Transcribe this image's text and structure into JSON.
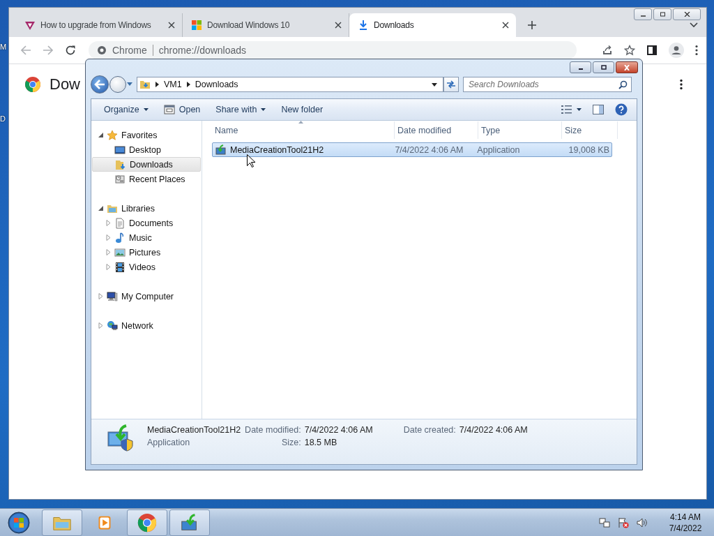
{
  "desktop": {
    "icon_labels": [
      "M",
      "D"
    ]
  },
  "browser": {
    "tabs": [
      {
        "title": "How to upgrade from Windows",
        "selected": false
      },
      {
        "title": "Download Windows 10",
        "selected": false
      },
      {
        "title": "Downloads",
        "selected": true
      }
    ],
    "address": {
      "site_label": "Chrome",
      "url": "chrome://downloads"
    },
    "page": {
      "heading": "Dow"
    }
  },
  "explorer": {
    "breadcrumb": [
      "VM1",
      "Downloads"
    ],
    "search": {
      "placeholder": "Search Downloads"
    },
    "commands": [
      {
        "label": "Organize",
        "menu": true
      },
      {
        "label": "Open",
        "menu": false
      },
      {
        "label": "Share with",
        "menu": true
      },
      {
        "label": "New folder",
        "menu": false
      }
    ],
    "nav": [
      {
        "label": "Favorites",
        "expanded": true,
        "children": [
          {
            "label": "Desktop",
            "selected": false
          },
          {
            "label": "Downloads",
            "selected": true
          },
          {
            "label": "Recent Places",
            "selected": false
          }
        ]
      },
      {
        "label": "Libraries",
        "expanded": true,
        "children": [
          {
            "label": "Documents",
            "selected": false,
            "expanded": false
          },
          {
            "label": "Music",
            "selected": false,
            "expanded": false
          },
          {
            "label": "Pictures",
            "selected": false,
            "expanded": false
          },
          {
            "label": "Videos",
            "selected": false,
            "expanded": false
          }
        ]
      },
      {
        "label": "My Computer",
        "expanded": false
      },
      {
        "label": "Network",
        "expanded": false
      }
    ],
    "columns": [
      {
        "label": "Name"
      },
      {
        "label": "Date modified"
      },
      {
        "label": "Type"
      },
      {
        "label": "Size"
      }
    ],
    "files": [
      {
        "name": "MediaCreationTool21H2",
        "date_modified": "7/4/2022 4:06 AM",
        "type": "Application",
        "size": "19,008 KB",
        "selected": true
      }
    ],
    "details": {
      "name": "MediaCreationTool21H2",
      "type": "Application",
      "fields": [
        {
          "label": "Date modified:",
          "value": "7/4/2022 4:06 AM"
        },
        {
          "label": "Size:",
          "value": "18.5 MB"
        },
        {
          "label": "Date created:",
          "value": "7/4/2022 4:06 AM"
        }
      ]
    }
  },
  "taskbar": {
    "buttons": [
      {
        "running": true
      },
      {
        "running": false
      },
      {
        "running": true
      },
      {
        "running": true
      }
    ],
    "clock": {
      "time": "4:14 AM",
      "date": "7/4/2022"
    }
  }
}
